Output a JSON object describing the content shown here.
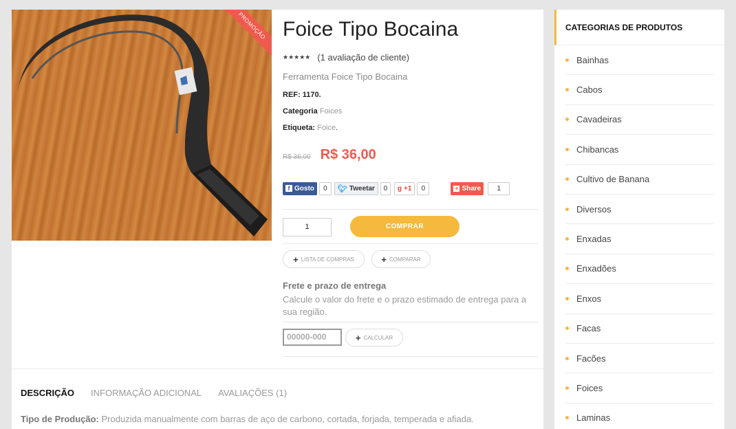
{
  "product": {
    "title": "Foice Tipo Bocaina",
    "ribbon": "PROMOÇÃO",
    "stars": "★★★★★",
    "rating_value": 5,
    "review_link": "(1 avaliação de cliente)",
    "short_description": "Ferramenta Foice Tipo Bocaina",
    "ref_label": "REF:",
    "ref_value": "1170.",
    "category_label": "Categoria",
    "category_value": "Foices",
    "tag_label": "Etiqueta:",
    "tag_value": "Foice",
    "tag_suffix": ".",
    "old_price": "R$ 36,00",
    "new_price": "R$ 36,00"
  },
  "share": {
    "facebook_label": "Gosto",
    "facebook_count": "0",
    "twitter_label": "Tweetar",
    "twitter_count": "0",
    "gplus_label": "+1",
    "gplus_count": "0",
    "share_label": "Share",
    "share_count": "1"
  },
  "cart": {
    "quantity": "1",
    "buy_label": "COMPRAR",
    "wishlist_label": "LISTA DE COMPRAS",
    "compare_label": "COMPARAR"
  },
  "shipping": {
    "title": "Frete e prazo de entrega",
    "description": "Calcule o valor do frete e o prazo estimado de entrega para a sua região.",
    "cep_placeholder": "00000-000",
    "calc_label": "CALCULAR"
  },
  "tabs": [
    {
      "label": "DESCRIÇÃO",
      "active": true
    },
    {
      "label": "INFORMAÇÃO ADICIONAL",
      "active": false
    },
    {
      "label": "AVALIAÇÕES (1)",
      "active": false
    }
  ],
  "description": {
    "label": "Tipo de Produção:",
    "text": " Produzida manualmente com barras de aço de carbono, cortada, forjada, temperada e afiada."
  },
  "sidebar": {
    "title": "CATEGORIAS DE PRODUTOS",
    "items": [
      "Bainhas",
      "Cabos",
      "Cavadeiras",
      "Chibancas",
      "Cultivo de Banana",
      "Diversos",
      "Enxadas",
      "Enxadões",
      "Enxos",
      "Facas",
      "Facões",
      "Foices",
      "Laminas"
    ]
  },
  "colors": {
    "accent": "#f5b93e",
    "price": "#f05a4e",
    "facebook": "#3b5998",
    "share": "#f05a4e"
  }
}
